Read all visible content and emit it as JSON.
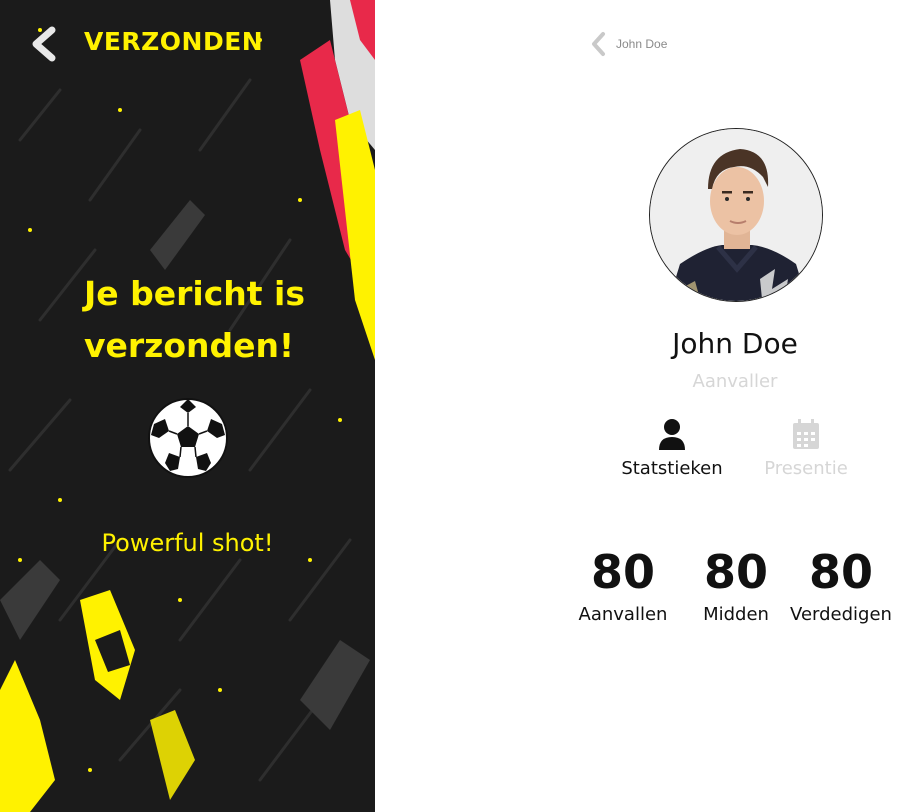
{
  "left_screen": {
    "title": "VERZONDEN",
    "message_line1": "Je bericht is",
    "message_line2": "verzonden!",
    "subtitle": "Powerful shot!",
    "icons": {
      "back": "chevron-left-icon",
      "ball": "soccer-ball-icon"
    },
    "colors": {
      "accent": "#fff200",
      "background": "#1b1b1b",
      "stripe_red": "#e8294a"
    }
  },
  "right_screen": {
    "nav": {
      "back_label": "John Doe"
    },
    "profile": {
      "name": "John Doe",
      "role": "Aanvaller"
    },
    "tabs": [
      {
        "label": "Statstieken",
        "icon": "user-icon",
        "active": true
      },
      {
        "label": "Presentie",
        "icon": "calendar-icon",
        "active": false
      }
    ],
    "stats": [
      {
        "value": "80",
        "label": "Aanvallen"
      },
      {
        "value": "80",
        "label": "Midden"
      },
      {
        "value": "80",
        "label": "Verdedigen"
      }
    ],
    "colors": {
      "text": "#111111",
      "muted": "#d6d6d6"
    }
  }
}
